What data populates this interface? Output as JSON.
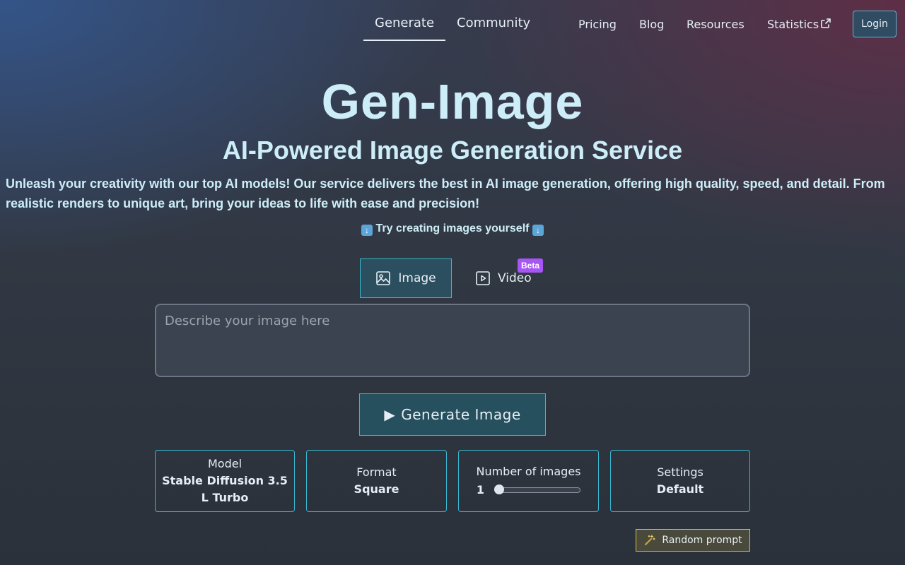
{
  "nav": {
    "main": [
      {
        "label": "Generate",
        "active": true
      },
      {
        "label": "Community",
        "active": false
      }
    ],
    "links": [
      "Pricing",
      "Blog",
      "Resources",
      "Statistics"
    ],
    "login_label": "Login"
  },
  "hero": {
    "title": "Gen-Image",
    "subtitle": "AI-Powered Image Generation Service",
    "description": "Unleash your creativity with our top AI models! Our service delivers the best in AI image generation, offering high quality, speed, and detail. From realistic renders to unique art, bring your ideas to life with ease and precision!",
    "try_text": "Try creating images yourself"
  },
  "tabs": {
    "image_label": "Image",
    "video_label": "Video",
    "beta_badge": "Beta"
  },
  "prompt": {
    "placeholder": "Describe your image here",
    "value": ""
  },
  "generate_button": {
    "icon": "play-icon",
    "label": "Generate Image"
  },
  "options": {
    "model": {
      "label": "Model",
      "value": "Stable Diffusion 3.5 L Turbo"
    },
    "format": {
      "label": "Format",
      "value": "Square"
    },
    "num_images": {
      "label": "Number of images",
      "value": "1",
      "slider_fraction": 0
    },
    "settings": {
      "label": "Settings",
      "value": "Default"
    }
  },
  "random_prompt": {
    "icon": "magic-wand-icon",
    "label": "Random prompt"
  },
  "colors": {
    "accent_border": "#39b7cf",
    "hero_text": "#cdeef8",
    "beta_badge": "#a855f7",
    "random_border": "#d9c23a"
  }
}
